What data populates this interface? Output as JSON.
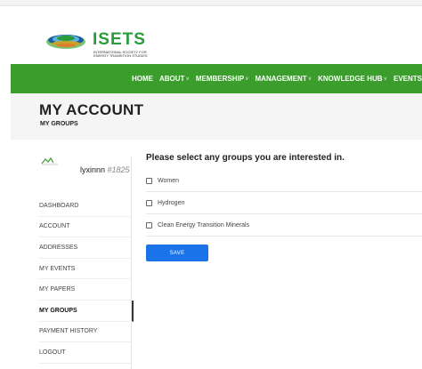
{
  "header": {
    "logo_text": "ISETS",
    "logo_subtitle_line1": "INTERNATIONAL SOCIETY FOR",
    "logo_subtitle_line2": "ENERGY TRANSITION STUDIES",
    "logo_colors": {
      "green": "#2a9d3a",
      "blue": "#1a5fa0"
    }
  },
  "nav": {
    "color": "#3a9d2c",
    "items": [
      {
        "label": "HOME",
        "dropdown": false
      },
      {
        "label": "ABOUT",
        "dropdown": true
      },
      {
        "label": "MEMBERSHIP",
        "dropdown": true
      },
      {
        "label": "MANAGEMENT",
        "dropdown": true
      },
      {
        "label": "KNOWLEDGE HUB",
        "dropdown": true
      },
      {
        "label": "EVENTS",
        "dropdown": false
      }
    ]
  },
  "page": {
    "title": "MY ACCOUNT",
    "breadcrumb": "MY GROUPS"
  },
  "user": {
    "name": "lyxinnn",
    "id": "#1825"
  },
  "sidebar": {
    "items": [
      {
        "label": "DASHBOARD",
        "active": false
      },
      {
        "label": "ACCOUNT",
        "active": false
      },
      {
        "label": "ADDRESSES",
        "active": false
      },
      {
        "label": "MY EVENTS",
        "active": false
      },
      {
        "label": "MY PAPERS",
        "active": false
      },
      {
        "label": "MY GROUPS",
        "active": true
      },
      {
        "label": "PAYMENT HISTORY",
        "active": false
      },
      {
        "label": "LOGOUT",
        "active": false
      }
    ]
  },
  "groups": {
    "heading": "Please select any groups you are interested in.",
    "options": [
      {
        "label": "Women",
        "checked": false
      },
      {
        "label": "Hydrogen",
        "checked": false
      },
      {
        "label": "Clean Energy Transition Minerals",
        "checked": false
      }
    ],
    "save_label": "SAVE",
    "save_color": "#1a73e8"
  }
}
